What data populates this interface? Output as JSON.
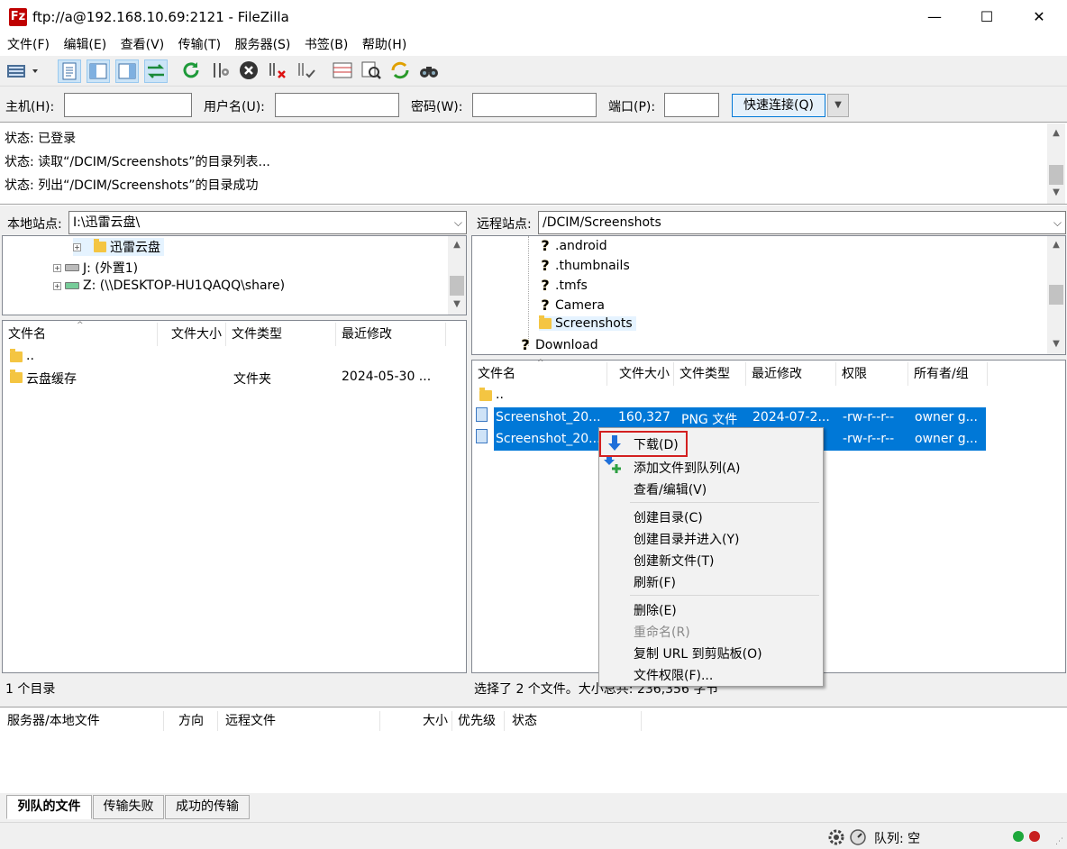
{
  "window": {
    "title": "ftp://a@192.168.10.69:2121 - FileZilla",
    "app_icon": "Fz",
    "minimize": "—",
    "maximize": "☐",
    "close": "✕"
  },
  "menu": [
    "文件(F)",
    "编辑(E)",
    "查看(V)",
    "传输(T)",
    "服务器(S)",
    "书签(B)",
    "帮助(H)"
  ],
  "connect": {
    "host_label": "主机(H):",
    "host_value": "",
    "user_label": "用户名(U):",
    "user_value": "",
    "pass_label": "密码(W):",
    "pass_value": "",
    "port_label": "端口(P):",
    "port_value": "",
    "quick_btn": "快速连接(Q)"
  },
  "log": [
    "状态:  已登录",
    "状态:  读取“/DCIM/Screenshots”的目录列表...",
    "状态:  列出“/DCIM/Screenshots”的目录成功"
  ],
  "local": {
    "site_label": "本地站点:",
    "path": "I:\\迅雷云盘\\",
    "tree": [
      "迅雷云盘",
      "J: (外置1)",
      "Z: (\\\\DESKTOP-HU1QAQQ\\share)"
    ],
    "headers": [
      "文件名",
      "文件大小",
      "文件类型",
      "最近修改"
    ],
    "rows": [
      {
        "name": "..",
        "size": "",
        "type": "",
        "modified": ""
      },
      {
        "name": "云盘缓存",
        "size": "",
        "type": "文件夹",
        "modified": "2024-05-30 ..."
      }
    ],
    "status": "1 个目录"
  },
  "remote": {
    "site_label": "远程站点:",
    "path": "/DCIM/Screenshots",
    "tree": [
      ".android",
      ".thumbnails",
      ".tmfs",
      "Camera",
      "Screenshots",
      "Download"
    ],
    "headers": [
      "文件名",
      "文件大小",
      "文件类型",
      "最近修改",
      "权限",
      "所有者/组"
    ],
    "rows": [
      {
        "name": "..",
        "size": "",
        "type": "",
        "modified": "",
        "perm": "",
        "owner": ""
      },
      {
        "name": "Screenshot_20...",
        "size": "160,327",
        "type": "PNG 文件",
        "modified": "2024-07-2...",
        "perm": "-rw-r--r--",
        "owner": "owner g..."
      },
      {
        "name": "Screenshot_20...",
        "size": "",
        "type": "",
        "modified": "",
        "perm": "-rw-r--r--",
        "owner": "owner g..."
      }
    ],
    "status": "选择了 2 个文件。大小总共: 236,356 字节"
  },
  "context_menu": {
    "download": "下载(D)",
    "add_queue": "添加文件到队列(A)",
    "view_edit": "查看/编辑(V)",
    "mkdir": "创建目录(C)",
    "mkdir_enter": "创建目录并进入(Y)",
    "new_file": "创建新文件(T)",
    "refresh": "刷新(F)",
    "delete": "删除(E)",
    "rename": "重命名(R)",
    "copy_url": "复制 URL 到剪贴板(O)",
    "permissions": "文件权限(F)..."
  },
  "queue": {
    "headers": [
      "服务器/本地文件",
      "方向",
      "远程文件",
      "大小",
      "优先级",
      "状态"
    ],
    "tabs": [
      "列队的文件",
      "传输失败",
      "成功的传输"
    ]
  },
  "statusbar": {
    "queue": "队列: 空"
  },
  "colors": {
    "selection": "#0078d7",
    "highlight_border": "#e02020",
    "download_arrow": "#1e6fd9",
    "add_plus": "#2ea043"
  }
}
